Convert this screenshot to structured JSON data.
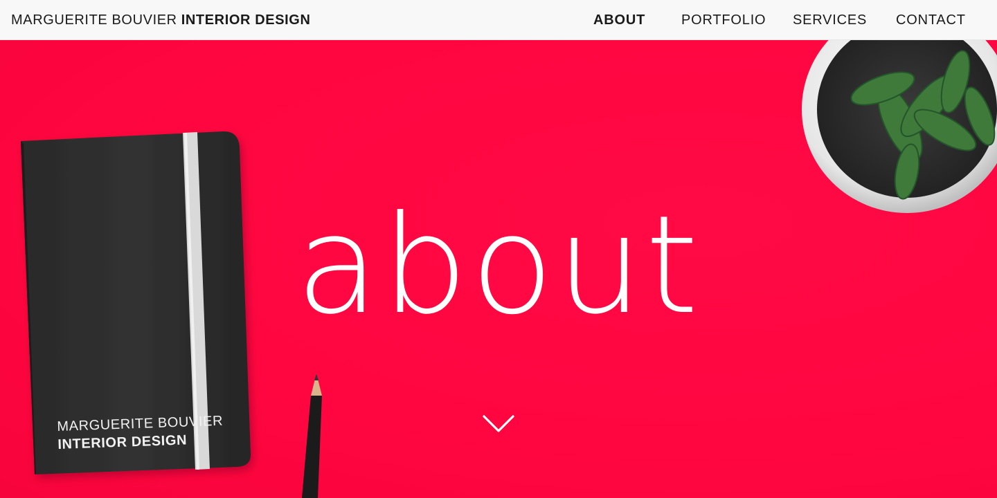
{
  "header": {
    "brand_name": "MARGUERITE BOUVIER",
    "brand_suffix": "INTERIOR DESIGN",
    "nav": [
      {
        "label": "ABOUT",
        "active": true
      },
      {
        "label": "PORTFOLIO",
        "active": false
      },
      {
        "label": "SERVICES",
        "active": false
      },
      {
        "label": "CONTACT",
        "active": false
      }
    ]
  },
  "hero": {
    "title": "about",
    "background_color": "#ff0840",
    "scroll_icon": "chevron-down-icon",
    "notebook": {
      "line1": "MARGUERITE BOUVIER",
      "line2": "INTERIOR DESIGN"
    }
  }
}
